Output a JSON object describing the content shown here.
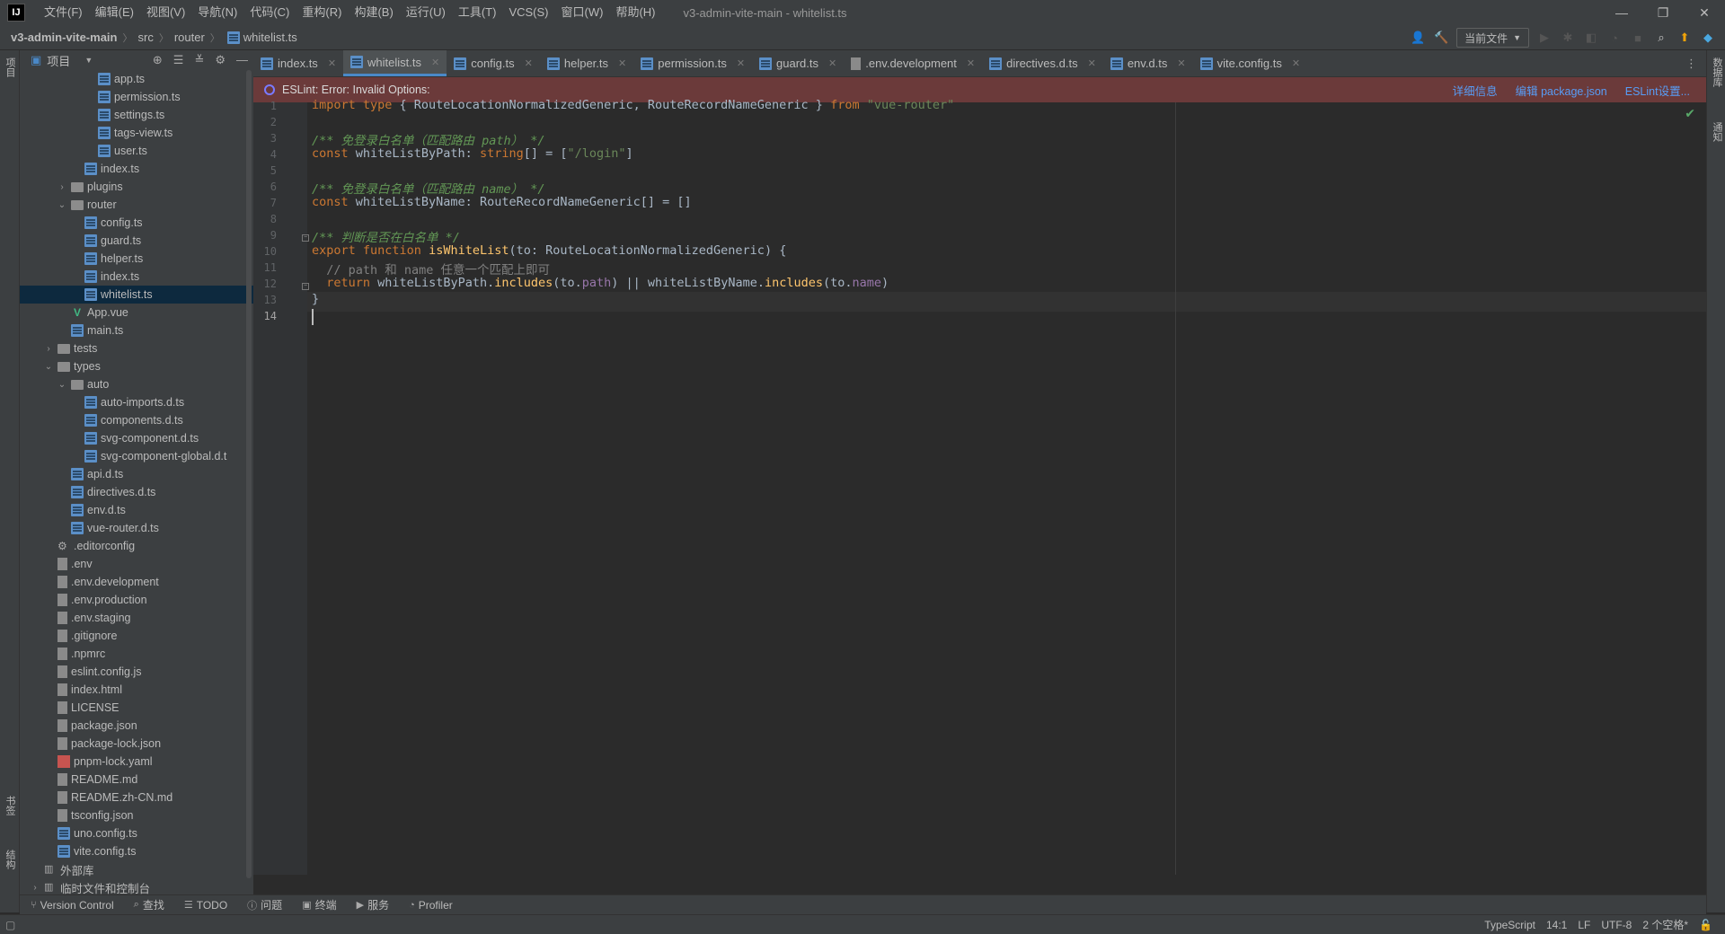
{
  "titlebar": {
    "logo": "IJ",
    "menu": [
      "文件(F)",
      "编辑(E)",
      "视图(V)",
      "导航(N)",
      "代码(C)",
      "重构(R)",
      "构建(B)",
      "运行(U)",
      "工具(T)",
      "VCS(S)",
      "窗口(W)",
      "帮助(H)"
    ],
    "window_title": "v3-admin-vite-main - whitelist.ts"
  },
  "breadcrumb": {
    "root": "v3-admin-vite-main",
    "items": [
      "src",
      "router",
      "whitelist.ts"
    ]
  },
  "toolbar": {
    "run_config": "当前文件"
  },
  "project_panel": {
    "title": "项目",
    "tree": [
      {
        "label": "app.ts",
        "icon": "ts",
        "indent": 5
      },
      {
        "label": "permission.ts",
        "icon": "ts",
        "indent": 5
      },
      {
        "label": "settings.ts",
        "icon": "ts",
        "indent": 5
      },
      {
        "label": "tags-view.ts",
        "icon": "ts",
        "indent": 5
      },
      {
        "label": "user.ts",
        "icon": "ts",
        "indent": 5
      },
      {
        "label": "index.ts",
        "icon": "ts",
        "indent": 4
      },
      {
        "label": "plugins",
        "icon": "folder",
        "indent": 3,
        "chev": "›"
      },
      {
        "label": "router",
        "icon": "folder",
        "indent": 3,
        "chev": "⌄"
      },
      {
        "label": "config.ts",
        "icon": "ts",
        "indent": 4
      },
      {
        "label": "guard.ts",
        "icon": "ts",
        "indent": 4
      },
      {
        "label": "helper.ts",
        "icon": "ts",
        "indent": 4
      },
      {
        "label": "index.ts",
        "icon": "ts",
        "indent": 4
      },
      {
        "label": "whitelist.ts",
        "icon": "ts",
        "indent": 4,
        "selected": true
      },
      {
        "label": "App.vue",
        "icon": "vue",
        "indent": 3
      },
      {
        "label": "main.ts",
        "icon": "ts",
        "indent": 3
      },
      {
        "label": "tests",
        "icon": "folder",
        "indent": 2,
        "chev": "›"
      },
      {
        "label": "types",
        "icon": "folder",
        "indent": 2,
        "chev": "⌄"
      },
      {
        "label": "auto",
        "icon": "folder",
        "indent": 3,
        "chev": "⌄"
      },
      {
        "label": "auto-imports.d.ts",
        "icon": "ts",
        "indent": 4
      },
      {
        "label": "components.d.ts",
        "icon": "ts",
        "indent": 4
      },
      {
        "label": "svg-component.d.ts",
        "icon": "ts",
        "indent": 4
      },
      {
        "label": "svg-component-global.d.t",
        "icon": "ts",
        "indent": 4
      },
      {
        "label": "api.d.ts",
        "icon": "ts",
        "indent": 3
      },
      {
        "label": "directives.d.ts",
        "icon": "ts",
        "indent": 3
      },
      {
        "label": "env.d.ts",
        "icon": "ts",
        "indent": 3
      },
      {
        "label": "vue-router.d.ts",
        "icon": "ts",
        "indent": 3
      },
      {
        "label": ".editorconfig",
        "icon": "gear",
        "indent": 2
      },
      {
        "label": ".env",
        "icon": "file",
        "indent": 2
      },
      {
        "label": ".env.development",
        "icon": "file",
        "indent": 2
      },
      {
        "label": ".env.production",
        "icon": "file",
        "indent": 2
      },
      {
        "label": ".env.staging",
        "icon": "file",
        "indent": 2
      },
      {
        "label": ".gitignore",
        "icon": "file",
        "indent": 2
      },
      {
        "label": ".npmrc",
        "icon": "file",
        "indent": 2
      },
      {
        "label": "eslint.config.js",
        "icon": "file",
        "indent": 2
      },
      {
        "label": "index.html",
        "icon": "file",
        "indent": 2
      },
      {
        "label": "LICENSE",
        "icon": "file",
        "indent": 2
      },
      {
        "label": "package.json",
        "icon": "file",
        "indent": 2
      },
      {
        "label": "package-lock.json",
        "icon": "file",
        "indent": 2
      },
      {
        "label": "pnpm-lock.yaml",
        "icon": "yaml",
        "indent": 2
      },
      {
        "label": "README.md",
        "icon": "file",
        "indent": 2
      },
      {
        "label": "README.zh-CN.md",
        "icon": "file",
        "indent": 2
      },
      {
        "label": "tsconfig.json",
        "icon": "file",
        "indent": 2
      },
      {
        "label": "uno.config.ts",
        "icon": "ts",
        "indent": 2
      },
      {
        "label": "vite.config.ts",
        "icon": "ts",
        "indent": 2
      },
      {
        "label": "外部库",
        "icon": "lib",
        "indent": 1
      },
      {
        "label": "临时文件和控制台",
        "icon": "lib",
        "indent": 1,
        "chev": "›"
      }
    ]
  },
  "tabs": [
    {
      "label": "index.ts",
      "active": false
    },
    {
      "label": "whitelist.ts",
      "active": true
    },
    {
      "label": "config.ts",
      "active": false
    },
    {
      "label": "helper.ts",
      "active": false
    },
    {
      "label": "permission.ts",
      "active": false
    },
    {
      "label": "guard.ts",
      "active": false
    },
    {
      "label": ".env.development",
      "active": false
    },
    {
      "label": "directives.d.ts",
      "active": false
    },
    {
      "label": "env.d.ts",
      "active": false
    },
    {
      "label": "vite.config.ts",
      "active": false
    }
  ],
  "banner": {
    "message": "ESLint: Error: Invalid Options:",
    "links": [
      "详细信息",
      "编辑 package.json",
      "ESLint设置..."
    ]
  },
  "editor": {
    "line_numbers": [
      "1",
      "2",
      "3",
      "4",
      "5",
      "6",
      "7",
      "8",
      "9",
      "10",
      "11",
      "12",
      "13",
      "14"
    ],
    "current_line": 14
  },
  "left_strip": {
    "project_label": "项目",
    "bookmarks_label": "书签",
    "structure_label": "结构"
  },
  "right_strip": {
    "db_label": "数据库",
    "notify_label": "通知"
  },
  "bottom_tools": [
    "Version Control",
    "查找",
    "TODO",
    "问题",
    "终端",
    "服务",
    "Profiler"
  ],
  "statusbar": {
    "language": "TypeScript",
    "position": "14:1",
    "line_sep": "LF",
    "encoding": "UTF-8",
    "indent": "2 个空格*"
  }
}
